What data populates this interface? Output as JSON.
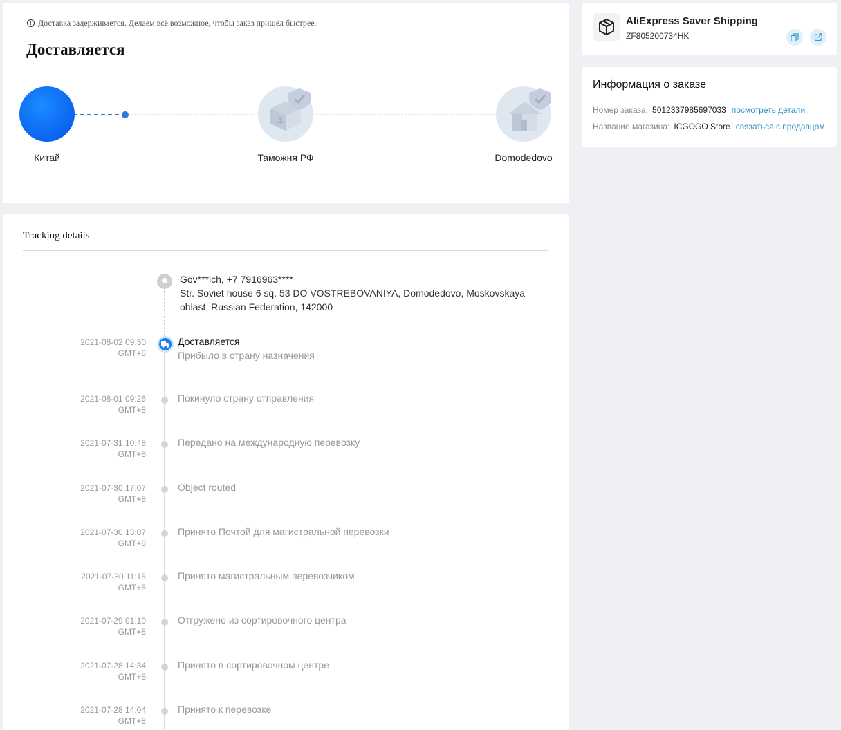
{
  "status": {
    "notice": "Доставка задерживается. Делаем всё возможное, чтобы заказ пришёл быстрее.",
    "title": "Доставляется",
    "stages": [
      "Китай",
      "Таможня РФ",
      "Domodedovo"
    ]
  },
  "tracking": {
    "title": "Tracking details",
    "recipient": "Gov***ich,  +7 7916963****",
    "address": "Str. Soviet house 6 sq. 53 DO VOSTREBOVANIYA,  Domodedovo,  Moskovskaya oblast,  Russian Federation,  142000",
    "events": [
      {
        "date": "2021-08-02 09:30",
        "tz": "GMT+8",
        "title": "Доставляется",
        "sub": "Прибыло в страну назначения"
      },
      {
        "date": "2021-08-01 09:26",
        "tz": "GMT+8",
        "title": "Покинуло страну отправления"
      },
      {
        "date": "2021-07-31 10:48",
        "tz": "GMT+8",
        "title": "Передано на международную перевозку"
      },
      {
        "date": "2021-07-30 17:07",
        "tz": "GMT+8",
        "title": "Object routed"
      },
      {
        "date": "2021-07-30 13:07",
        "tz": "GMT+8",
        "title": "Принято Почтой для магистральной перевозки"
      },
      {
        "date": "2021-07-30 11:15",
        "tz": "GMT+8",
        "title": "Принято магистральным перевозчиком"
      },
      {
        "date": "2021-07-29 01:10",
        "tz": "GMT+8",
        "title": "Отгружено из сортировочного центра"
      },
      {
        "date": "2021-07-28 14:34",
        "tz": "GMT+8",
        "title": "Принято в сортировочном центре"
      },
      {
        "date": "2021-07-28 14:04",
        "tz": "GMT+8",
        "title": "Принято к перевозке"
      }
    ]
  },
  "shipping": {
    "carrier": "AliExpress Saver Shipping",
    "tracking_number": "ZF805200734HK"
  },
  "order": {
    "title": "Информация о заказе",
    "number_label": "Номер заказа:",
    "number": "5012337985697033",
    "details_link": "посмотреть детали",
    "store_label": "Название магазина:",
    "store": "ICGOGO Store",
    "contact_link": "связаться с продавцом"
  },
  "colors": {
    "accent": "#1e7fe6",
    "link": "#2a8fc7",
    "background": "#eef0f4"
  }
}
